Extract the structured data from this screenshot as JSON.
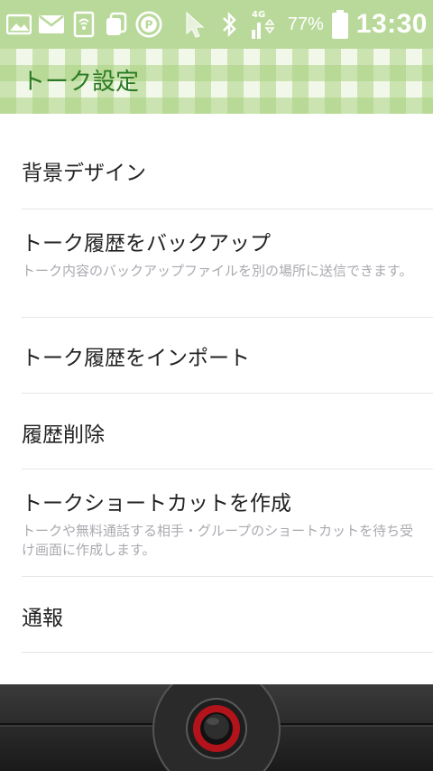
{
  "status": {
    "battery_percent": "77%",
    "time": "13:30",
    "network": "4G"
  },
  "header": {
    "title": "トーク設定"
  },
  "items": [
    {
      "title": "背景デザイン",
      "subtitle": ""
    },
    {
      "title": "トーク履歴をバックアップ",
      "subtitle": "トーク内容のバックアップファイルを別の場所に送信できます。"
    },
    {
      "title": "トーク履歴をインポート",
      "subtitle": ""
    },
    {
      "title": "履歴削除",
      "subtitle": ""
    },
    {
      "title": "トークショートカットを作成",
      "subtitle": "トークや無料通話する相手・グループのショートカットを待ち受け画面に作成します。"
    },
    {
      "title": "通報",
      "subtitle": ""
    }
  ],
  "colors": {
    "accent": "#2b7a24",
    "statusbar": "#b9d99a"
  }
}
